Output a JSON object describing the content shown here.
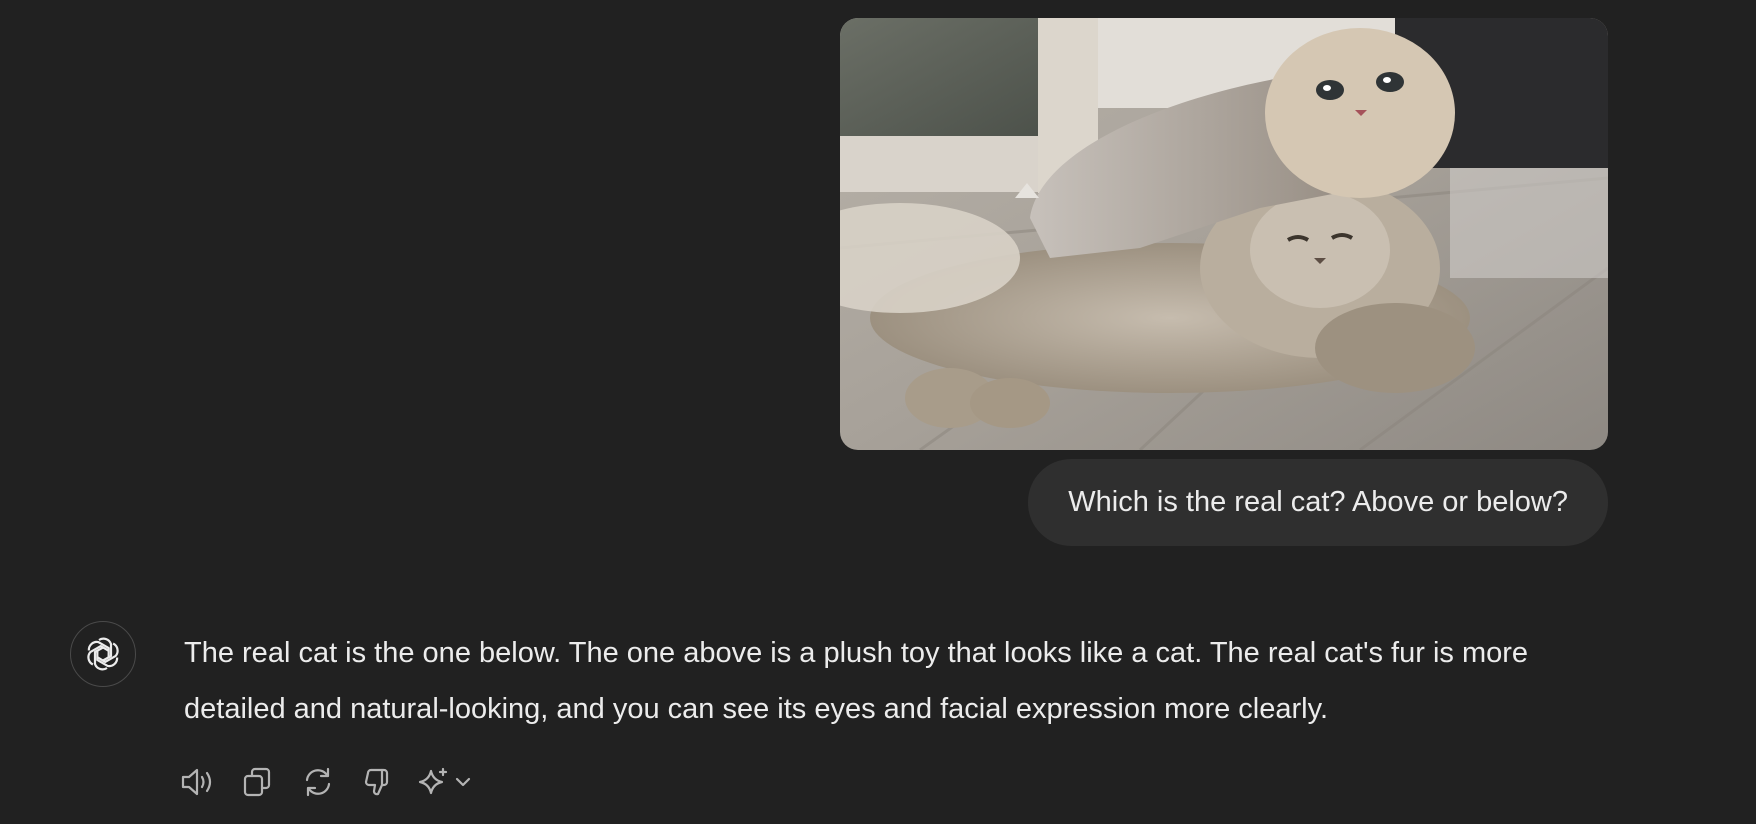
{
  "conversation": {
    "user_message": {
      "image_description": "photo",
      "text": "Which is the real cat? Above or below?"
    },
    "assistant_message": {
      "text": "The real cat is the one below. The one above is a plush toy that looks like a cat. The real cat's fur is more detailed and natural-looking, and you can see its eyes and facial expression more clearly."
    }
  },
  "actions": {
    "icons": [
      "speaker-icon",
      "copy-icon",
      "regenerate-icon",
      "thumbs-down-icon",
      "sparkle-icon",
      "chevron-down-icon"
    ]
  },
  "colors": {
    "background": "#212121",
    "bubble": "#2f2f2f",
    "text": "#ececec",
    "icon": "#b4b4b4"
  }
}
